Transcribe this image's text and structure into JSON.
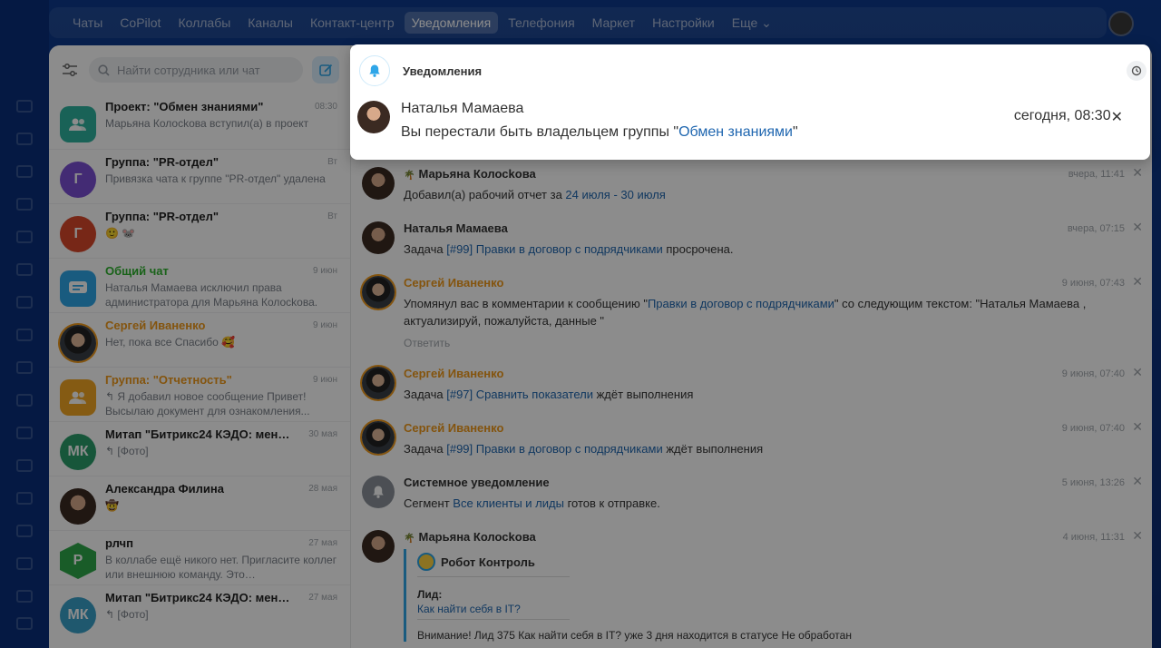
{
  "topnav": {
    "items": [
      "Чаты",
      "CoPilot",
      "Коллабы",
      "Каналы",
      "Контакт-центр",
      "Уведомления",
      "Телефония",
      "Маркет",
      "Настройки",
      "Еще"
    ],
    "active_index": 5
  },
  "search": {
    "placeholder": "Найти сотрудника или чат"
  },
  "chats": [
    {
      "title": "Проект: \"Обмен знаниями\"",
      "preview": "Марьяна Колосkова вступил(а) в проект",
      "date": "08:30",
      "avatar": "group-icon",
      "color": "#2fb39e"
    },
    {
      "title": "Группа: \"PR-отдел\"",
      "preview": "Привязка чата к группе \"PR-отдел\" удалена",
      "date": "Вт",
      "avatar_letter": "Г",
      "color": "#7a4fd3"
    },
    {
      "title": "Группа: \"PR-отдел\"",
      "preview": "🙂 🐭",
      "date": "Вт",
      "avatar_letter": "Г",
      "color": "#d9472b"
    },
    {
      "title": "Общий чат",
      "preview": "Наталья Мамаева исключил права администратора для Марьяна Колосkова.",
      "date": "9 июн",
      "avatar": "chat-icon",
      "color": "#2fa6e8",
      "title_color": "green"
    },
    {
      "title": "Сергей Иваненко",
      "preview": "Нет, пока все Спасибо 🥰",
      "date": "9 июн",
      "avatar": "person",
      "color": "#555",
      "title_color": "orange"
    },
    {
      "title": "Группа: \"Отчетность\"",
      "preview": "↰ Я добавил новое сообщение Привет! Высылаю документ для ознакомления...",
      "date": "9 июн",
      "avatar": "group-icon",
      "color": "#f2a623",
      "title_color": "orange"
    },
    {
      "title": "Митап \"Битрикс24 КЭДО: меньш…",
      "preview": "↰ [Фото]",
      "date": "30 мая",
      "avatar_letter": "МК",
      "color": "#2a9d6b"
    },
    {
      "title": "Александра Филина",
      "preview": "🤠",
      "date": "28 мая",
      "avatar": "person",
      "color": "#888"
    },
    {
      "title": "рлчп",
      "preview": "В коллабе ещё никого нет. Пригласите коллег или внешнюю команду. Это…",
      "date": "27 мая",
      "avatar_letter": "Р",
      "color": "#2fa84a"
    },
    {
      "title": "Митап \"Битрикс24 КЭДО: меньш…",
      "preview": "↰ [Фото]",
      "date": "27 мая",
      "avatar_letter": "МК",
      "color": "#3aa0c8"
    }
  ],
  "popup": {
    "title": "Уведомления",
    "notification": {
      "name": "Наталья Мамаева",
      "text_before": "Вы перестали быть владельцем группы \"",
      "link": "Обмен знаниями",
      "text_after": "\"",
      "date": "сегодня, 08:30"
    }
  },
  "feed": [
    {
      "name": "Марьяна Колосkова",
      "prefix": "🌴",
      "date": "вчера, 11:41",
      "before": "Добавил(а) рабочий отчет за ",
      "link": "24 июля - 30 июля",
      "after": ""
    },
    {
      "name": "Наталья Мамаева",
      "date": "вчера, 07:15",
      "before": "Задача ",
      "link": "[#99] Правки в договор с подрядчиками",
      "after": " просрочена."
    },
    {
      "name": "Сергей Иваненко",
      "orange": true,
      "date": "9 июня, 07:43",
      "before": "Упомянул вас в комментарии к сообщению \"",
      "link": "Правки в договор с подрядчиками",
      "after": "\" со следующим текстом: \"Наталья Мамаева , актуализируй, пожалуйста, данные \"",
      "reply": "Ответить"
    },
    {
      "name": "Сергей Иваненко",
      "orange": true,
      "date": "9 июня, 07:40",
      "before": "Задача ",
      "link": "[#97] Сравнить показатели",
      "after": " ждёт выполнения"
    },
    {
      "name": "Сергей Иваненко",
      "orange": true,
      "date": "9 июня, 07:40",
      "before": "Задача ",
      "link": "[#99] Правки в договор с подрядчиками",
      "after": " ждёт выполнения"
    },
    {
      "name": "Системное уведомление",
      "date": "5 июня, 13:26",
      "before": "Сегмент ",
      "link": "Все клиенты и лиды",
      "after": " готов к отправке."
    },
    {
      "name": "Марьяна Колосkова",
      "prefix": "🌴",
      "date": "4 июня, 11:31"
    }
  ],
  "robot": {
    "title": "Робот Контроль",
    "lead_label": "Лид:",
    "lead_link": "Как найти себя в IT?",
    "warning": "Внимание! Лид 375 Как найти себя в IT? уже 3 дня находится в статусе Не обработан"
  },
  "colors": {
    "accent": "#2fa6e8",
    "link": "#2067b0",
    "orange": "#f09a1a",
    "green": "#2fb32f"
  }
}
